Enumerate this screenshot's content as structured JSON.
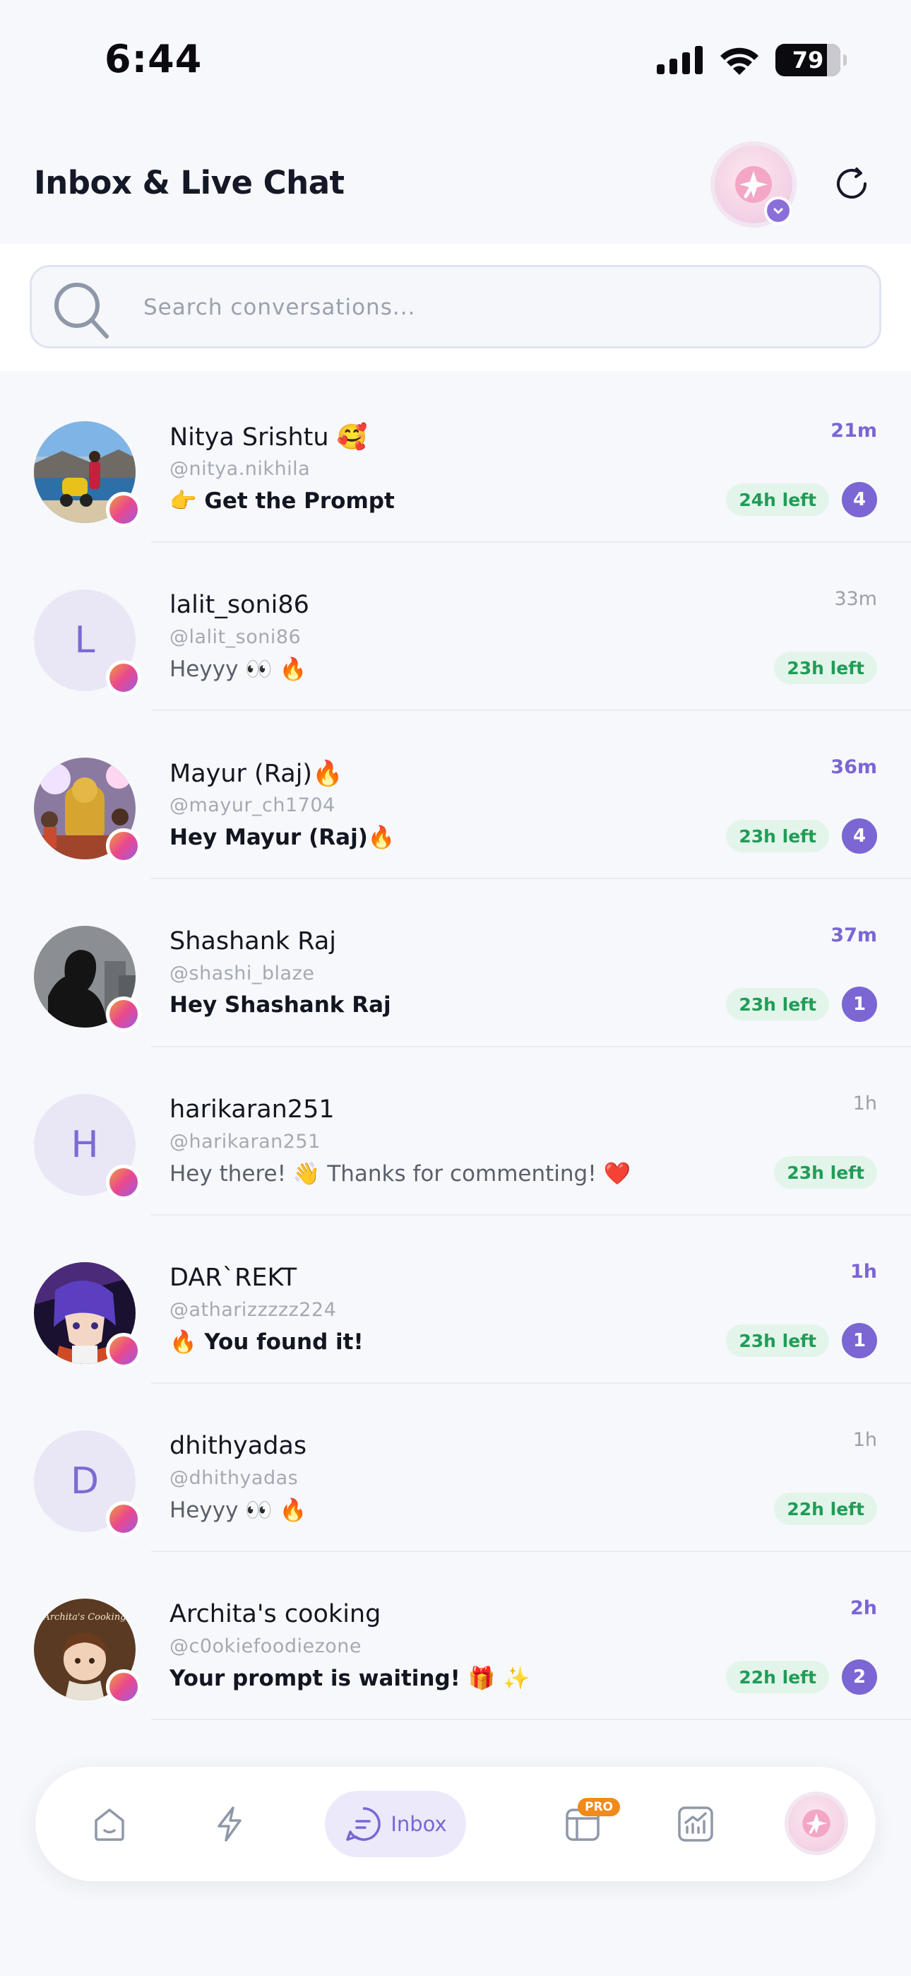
{
  "status_bar": {
    "time": "6:44",
    "battery": "79",
    "battery_fraction": 0.79
  },
  "header": {
    "title": "Inbox & Live Chat"
  },
  "search": {
    "placeholder": "Search conversations..."
  },
  "conversations": [
    {
      "name": "Nitya Srishtu 🥰",
      "handle": "@nitya.nikhila",
      "message": "👉 Get the Prompt",
      "time": "21m",
      "time_left": "24h left",
      "unread": "4",
      "is_unread": true,
      "avatar": "photo-scooter"
    },
    {
      "name": "lalit_soni86",
      "handle": "@lalit_soni86",
      "message": "Heyyy 👀 🔥",
      "time": "33m",
      "time_left": "23h left",
      "unread": "",
      "is_unread": false,
      "avatar": "letter",
      "initial": "L"
    },
    {
      "name": "Mayur (Raj)🔥",
      "handle": "@mayur_ch1704",
      "message": "Hey Mayur (Raj)🔥",
      "time": "36m",
      "time_left": "23h left",
      "unread": "4",
      "is_unread": true,
      "avatar": "photo-ganesha"
    },
    {
      "name": "Shashank Raj",
      "handle": "@shashi_blaze",
      "message": "Hey Shashank Raj",
      "time": "37m",
      "time_left": "23h left",
      "unread": "1",
      "is_unread": true,
      "avatar": "photo-silhouette"
    },
    {
      "name": "harikaran251",
      "handle": "@harikaran251",
      "message": "Hey there! 👋 Thanks for commenting! ❤️",
      "time": "1h",
      "time_left": "23h left",
      "unread": "",
      "is_unread": false,
      "avatar": "letter",
      "initial": "H"
    },
    {
      "name": "DAR`REKT",
      "handle": "@atharizzzzz224",
      "message": "🔥 You found it!",
      "time": "1h",
      "time_left": "23h left",
      "unread": "1",
      "is_unread": true,
      "avatar": "photo-anime"
    },
    {
      "name": "dhithyadas",
      "handle": "@dhithyadas",
      "message": "Heyyy 👀 🔥",
      "time": "1h",
      "time_left": "22h left",
      "unread": "",
      "is_unread": false,
      "avatar": "letter",
      "initial": "D"
    },
    {
      "name": "Archita's cooking",
      "handle": "@c0okiefoodiezone",
      "message": "Your prompt is waiting! 🎁 ✨",
      "time": "2h",
      "time_left": "22h left",
      "unread": "2",
      "is_unread": true,
      "avatar": "photo-cooking",
      "avatar_text": "Archita's Cooking"
    }
  ],
  "bottom_nav": {
    "items": [
      {
        "icon": "home-icon"
      },
      {
        "icon": "bolt-icon"
      },
      {
        "icon": "chat-icon",
        "label": "Inbox",
        "active": true
      },
      {
        "icon": "browser-icon",
        "badge": "PRO"
      },
      {
        "icon": "analytics-icon"
      },
      {
        "icon": "profile-avatar"
      }
    ]
  },
  "colors": {
    "accent": "#7b66d4",
    "time_left_bg": "#e3f5ea",
    "time_left_text": "#1f9d57",
    "background": "#f7f8fb"
  }
}
